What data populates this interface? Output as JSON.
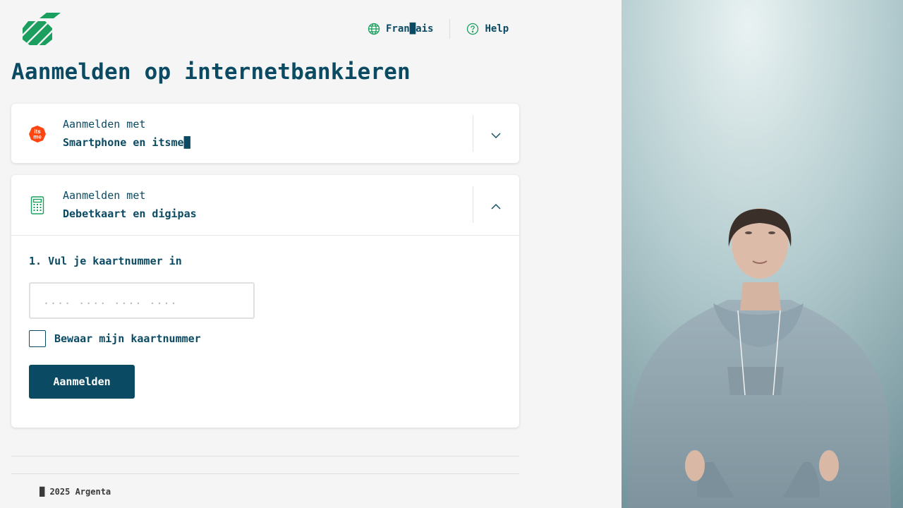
{
  "header": {
    "language_label": "Fran█ais",
    "help_label": "Help"
  },
  "page": {
    "title": "Aanmelden op internetbankieren"
  },
  "login_options": [
    {
      "small_label": "Aanmelden met",
      "method": "Smartphone en itsme█",
      "icon": "itsme-icon",
      "expanded": false
    },
    {
      "small_label": "Aanmelden met",
      "method": "Debetkaart en digipas",
      "icon": "calculator-icon",
      "expanded": true
    }
  ],
  "card_form": {
    "step_label": "1. Vul je kaartnummer in",
    "card_number_value": "",
    "card_number_placeholder": ".... .... .... ....",
    "remember_label": "Bewaar mijn kaartnummer",
    "remember_checked": false,
    "submit_label": "Aanmelden"
  },
  "footer": {
    "copyright": "█ 2025 Argenta"
  },
  "colors": {
    "brand_green": "#1a9f5e",
    "primary_navy": "#0b4a63",
    "itsme_orange": "#ff4612",
    "background": "#f5f5f5"
  }
}
